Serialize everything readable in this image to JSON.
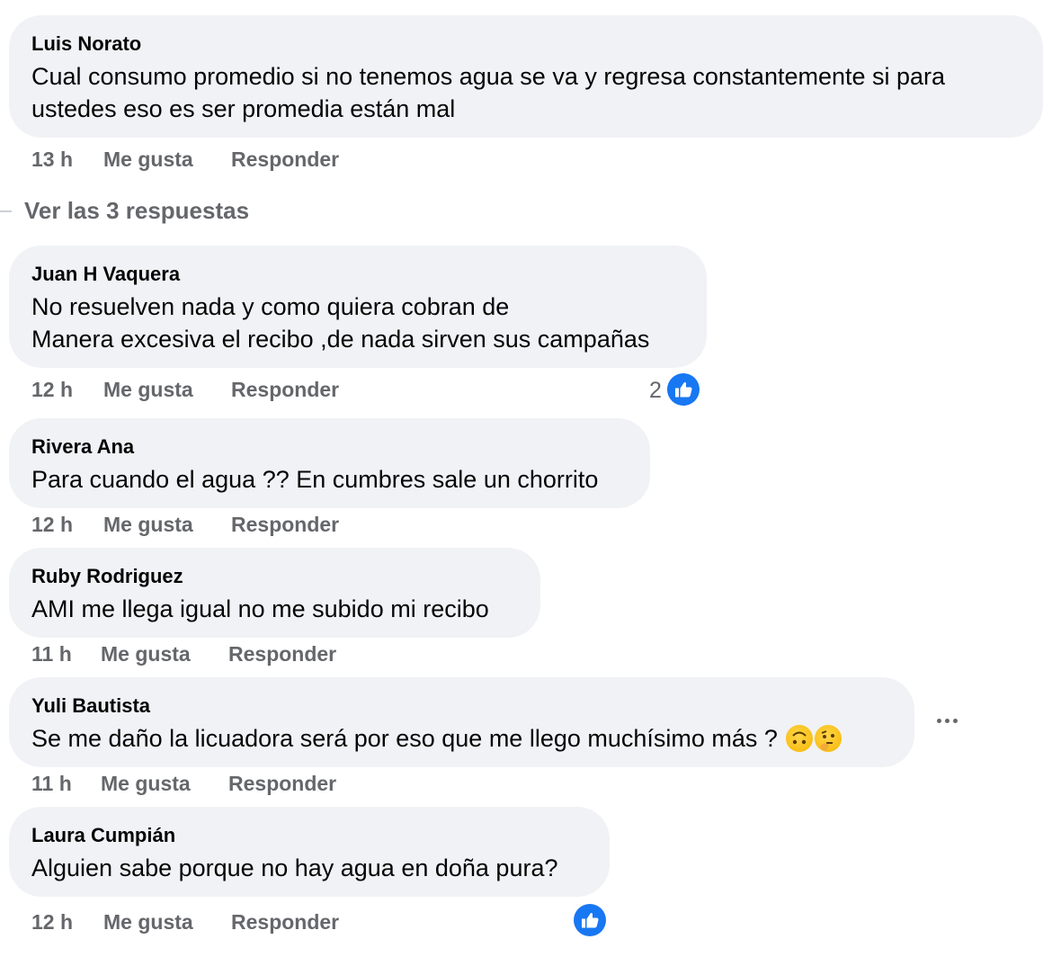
{
  "comments": [
    {
      "author": "Luis Norato",
      "text": "Cual consumo promedio si no tenemos agua se va y regresa constantemente si para\nustedes eso es ser promedia están mal",
      "time": "13 h",
      "like_label": "Me gusta",
      "reply_label": "Responder"
    },
    {
      "author": "Juan H Vaquera",
      "text": "No resuelven nada y como quiera cobran de\nManera excesiva el recibo ,de nada sirven sus campañas",
      "time": "12 h",
      "like_label": "Me gusta",
      "reply_label": "Responder",
      "reaction_count": "2"
    },
    {
      "author": "Rivera Ana",
      "text": "Para cuando el agua ?? En cumbres sale un chorrito",
      "time": "12 h",
      "like_label": "Me gusta",
      "reply_label": "Responder"
    },
    {
      "author": "Ruby Rodriguez",
      "text": "AMI me llega igual no me subido mi recibo",
      "time": "11 h",
      "like_label": "Me gusta",
      "reply_label": "Responder"
    },
    {
      "author": "Yuli Bautista",
      "text": "Se me daño la licuadora será por eso que me llego muchísimo más ?",
      "time": "11 h",
      "like_label": "Me gusta",
      "reply_label": "Responder",
      "emojis": [
        "upside-down-face",
        "thinking-face"
      ]
    },
    {
      "author": "Laura Cumpián",
      "text": "Alguien sabe porque no hay agua en doña pura?",
      "time": "12 h",
      "like_label": "Me gusta",
      "reply_label": "Responder",
      "reaction": "like"
    }
  ],
  "view_replies": "Ver las 3 respuestas",
  "more_options_icon": "ellipsis-icon",
  "colors": {
    "bubble": "#f0f2f5",
    "secondary_text": "#65676b",
    "like_blue": "#1877f2"
  }
}
